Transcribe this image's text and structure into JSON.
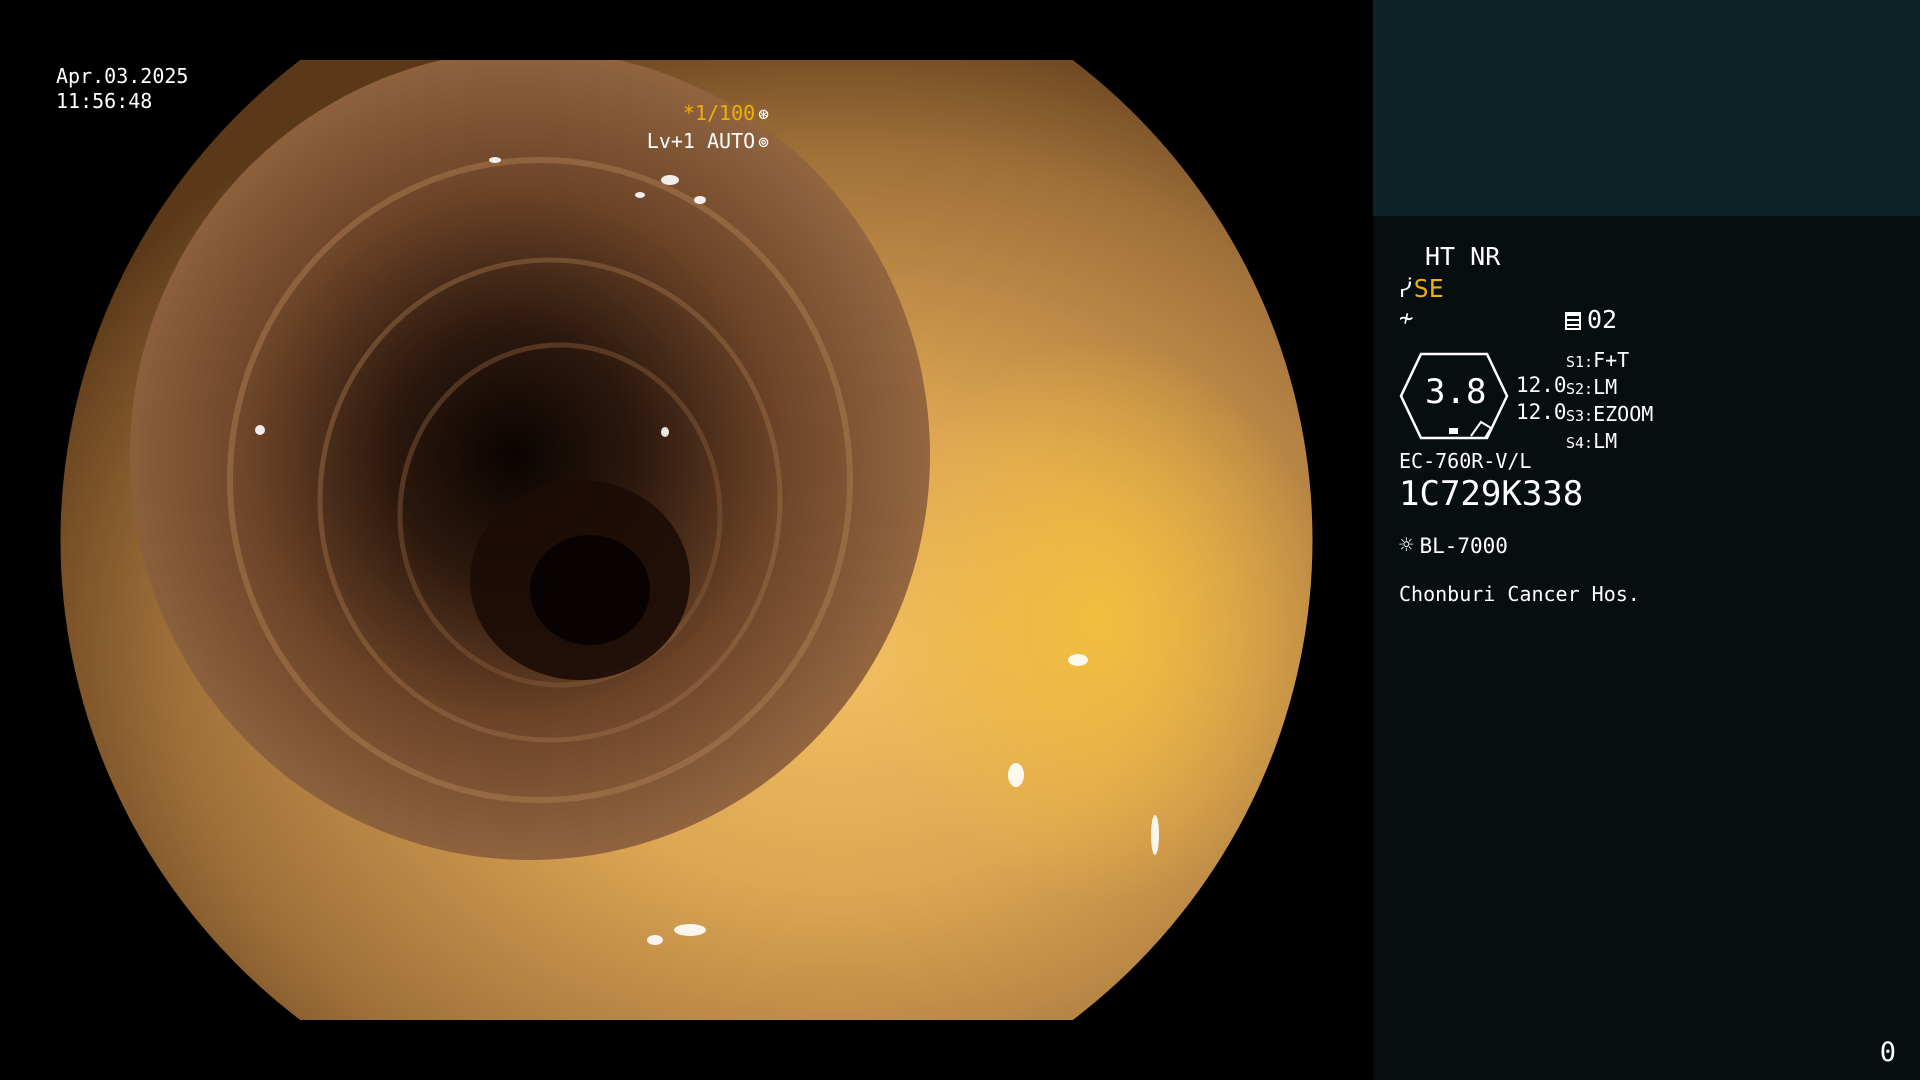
{
  "datetime": {
    "date": "Apr.03.2025",
    "time": "11:56:48"
  },
  "zoom": {
    "ratio": "*1/100",
    "ratio_icon": "shutter-icon",
    "level": "Lv+1 AUTO",
    "level_icon": "iris-icon"
  },
  "panel": {
    "ht_nr": "HT NR",
    "se_label": "SE",
    "se_icon": "structure-enhance-icon",
    "noise_icon": "noise-reduction-icon",
    "memory_label": "02",
    "memory_icon": "memory-card-icon",
    "scope_value": "3.8",
    "setting_values": [
      "12.0",
      "12.0"
    ],
    "s_list": [
      {
        "key": "S1:",
        "value": "F+T"
      },
      {
        "key": "S2:",
        "value": "LM"
      },
      {
        "key": "S3:",
        "value": "EZOOM"
      },
      {
        "key": "S4:",
        "value": "LM"
      }
    ],
    "scope_model": "EC-760R-V/L",
    "scope_serial": "1C729K338",
    "light_icon": "lamp-icon",
    "light_source": "BL-7000",
    "hospital": "Chonburi Cancer Hos."
  },
  "corner_number": "0",
  "colors": {
    "accent": "#f0b000",
    "panel_top": "#0c2327",
    "panel_bg": "#060e0f",
    "text": "#ffffff"
  }
}
